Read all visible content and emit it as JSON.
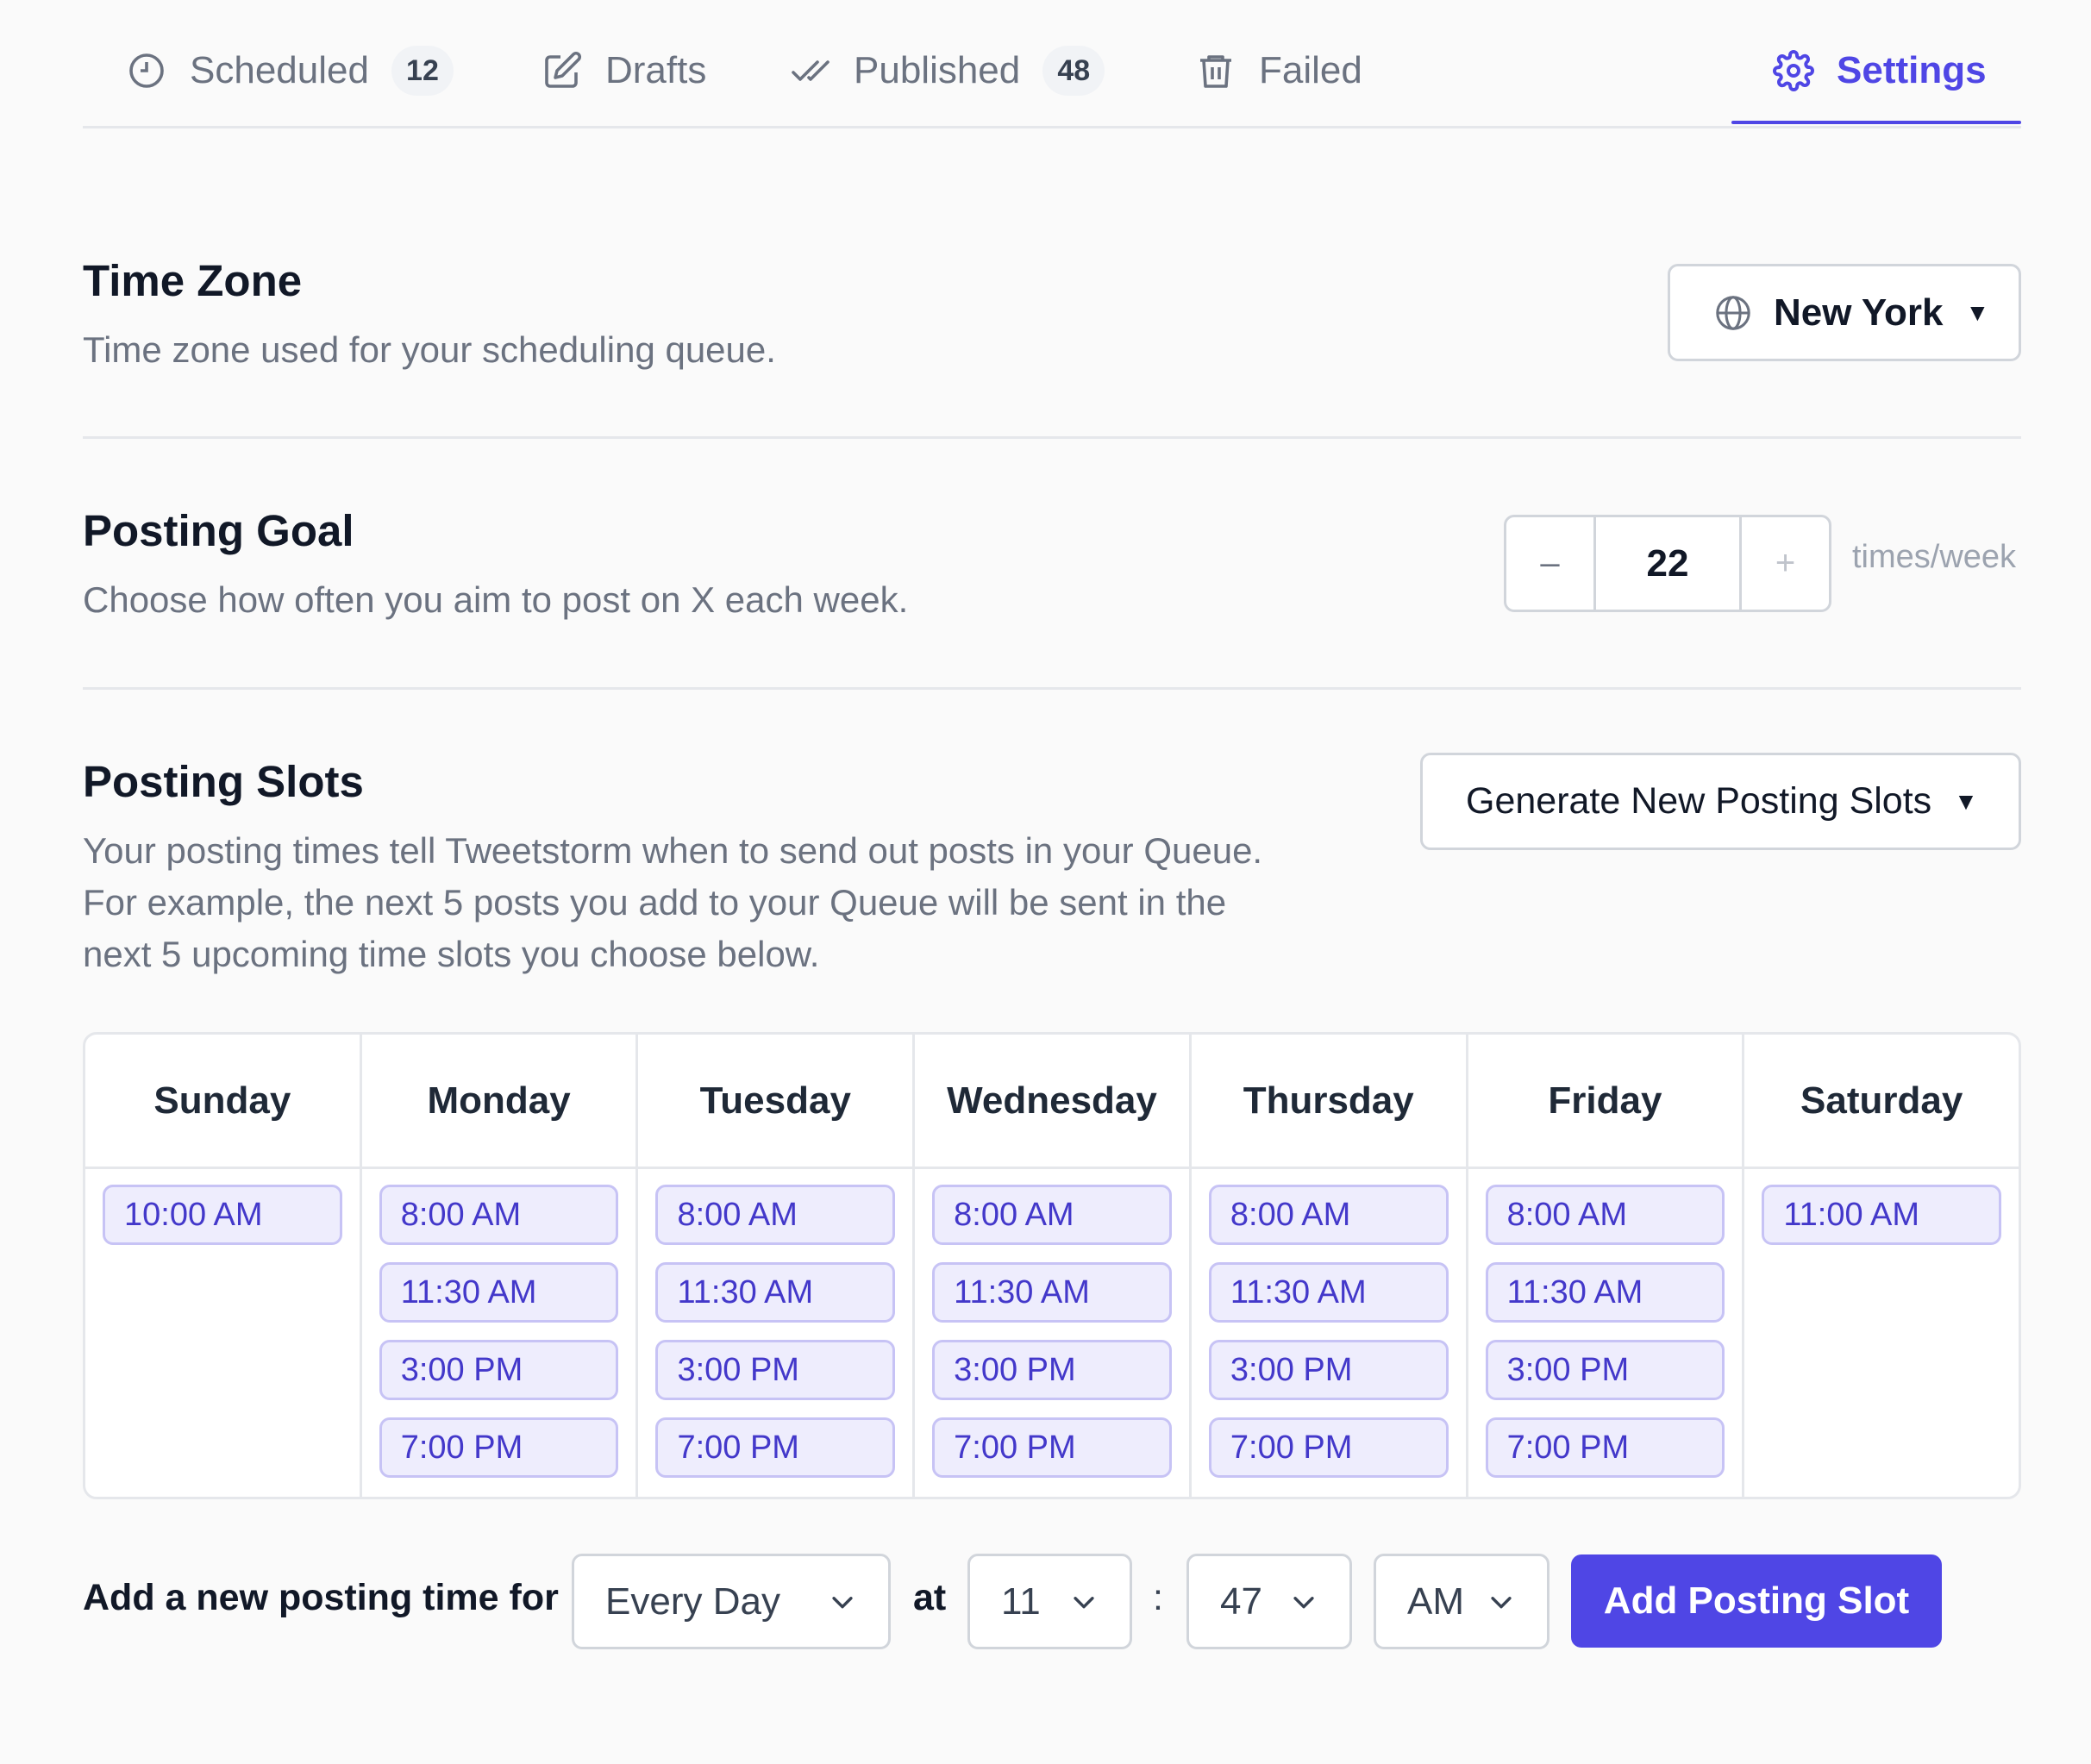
{
  "tabs": {
    "scheduled": {
      "label": "Scheduled",
      "count": "12"
    },
    "drafts": {
      "label": "Drafts"
    },
    "published": {
      "label": "Published",
      "count": "48"
    },
    "failed": {
      "label": "Failed"
    },
    "settings": {
      "label": "Settings"
    },
    "active": "settings",
    "accent_color": "#4f46e5"
  },
  "timezone": {
    "title": "Time Zone",
    "description": "Time zone used for your scheduling queue.",
    "selected": "New York"
  },
  "posting_goal": {
    "title": "Posting Goal",
    "description": "Choose how often you aim to post on X each week.",
    "decrement_label": "–",
    "value": "22",
    "increment_label": "+",
    "unit": "times/week"
  },
  "posting_slots": {
    "title": "Posting Slots",
    "description_lines": [
      "Your posting times tell Tweetstorm when to send out posts in your Queue.",
      "For example, the next 5 posts you add to your Queue will be sent in the",
      "next 5 upcoming time slots you choose below."
    ],
    "generate_label": "Generate New Posting Slots",
    "days": [
      {
        "name": "Sunday",
        "slots": [
          "10:00 AM"
        ]
      },
      {
        "name": "Monday",
        "slots": [
          "8:00 AM",
          "11:30 AM",
          "3:00 PM",
          "7:00 PM"
        ]
      },
      {
        "name": "Tuesday",
        "slots": [
          "8:00 AM",
          "11:30 AM",
          "3:00 PM",
          "7:00 PM"
        ]
      },
      {
        "name": "Wednesday",
        "slots": [
          "8:00 AM",
          "11:30 AM",
          "3:00 PM",
          "7:00 PM"
        ]
      },
      {
        "name": "Thursday",
        "slots": [
          "8:00 AM",
          "11:30 AM",
          "3:00 PM",
          "7:00 PM"
        ]
      },
      {
        "name": "Friday",
        "slots": [
          "8:00 AM",
          "11:30 AM",
          "3:00 PM",
          "7:00 PM"
        ]
      },
      {
        "name": "Saturday",
        "slots": [
          "11:00 AM"
        ]
      }
    ]
  },
  "add_slot": {
    "label": "Add a new posting time for",
    "day_value": "Every Day",
    "at_label": "at",
    "hour": "11",
    "separator": ":",
    "minute": "47",
    "period": "AM",
    "button_label": "Add Posting Slot"
  }
}
